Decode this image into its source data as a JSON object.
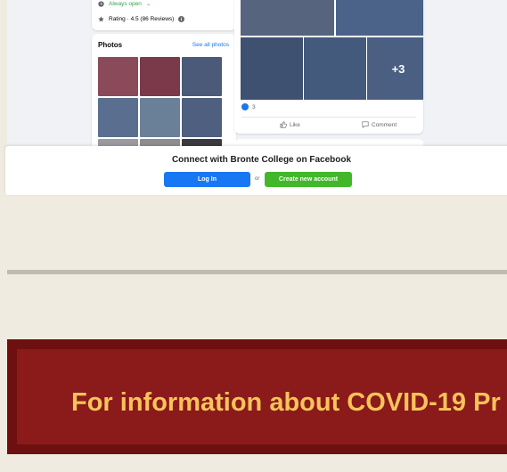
{
  "facebook_embed": {
    "hours": "Always open",
    "hours_chevron": "⌄",
    "rating": "Rating · 4.5 (86 Reviews)",
    "photos_title": "Photos",
    "see_all_photos": "See all photos",
    "photos": [
      {
        "color": "#8a4a5a"
      },
      {
        "color": "#7a3a4a"
      },
      {
        "color": "#4a5a78"
      },
      {
        "color": "#5a6f90"
      },
      {
        "color": "#6a7f98"
      },
      {
        "color": "#4e5f80"
      },
      {
        "color": "#9a9aa0"
      },
      {
        "color": "#8d8d92"
      },
      {
        "color": "#3a3a40"
      }
    ],
    "post_photos": [
      {
        "color": "#56647e"
      },
      {
        "color": "#4b6388"
      },
      {
        "color": "#3f5170"
      },
      {
        "color": "#445a7c"
      },
      {
        "color": "#4a5f82"
      }
    ],
    "more_photos": "+3",
    "reaction_count": "3",
    "like_label": "Like",
    "comment_label": "Comment"
  },
  "connect": {
    "title": "Connect with Bronte College on Facebook",
    "login_label": "Log In",
    "or_label": "or",
    "create_label": "Create new account"
  },
  "banner": {
    "text": "For information about COVID-19 Pr"
  },
  "colors": {
    "facebook_blue": "#1877f2",
    "facebook_green": "#42b72a",
    "banner_red": "#8b1a1a",
    "banner_text": "#f7c35a",
    "page_bg": "#f0ebe0"
  }
}
